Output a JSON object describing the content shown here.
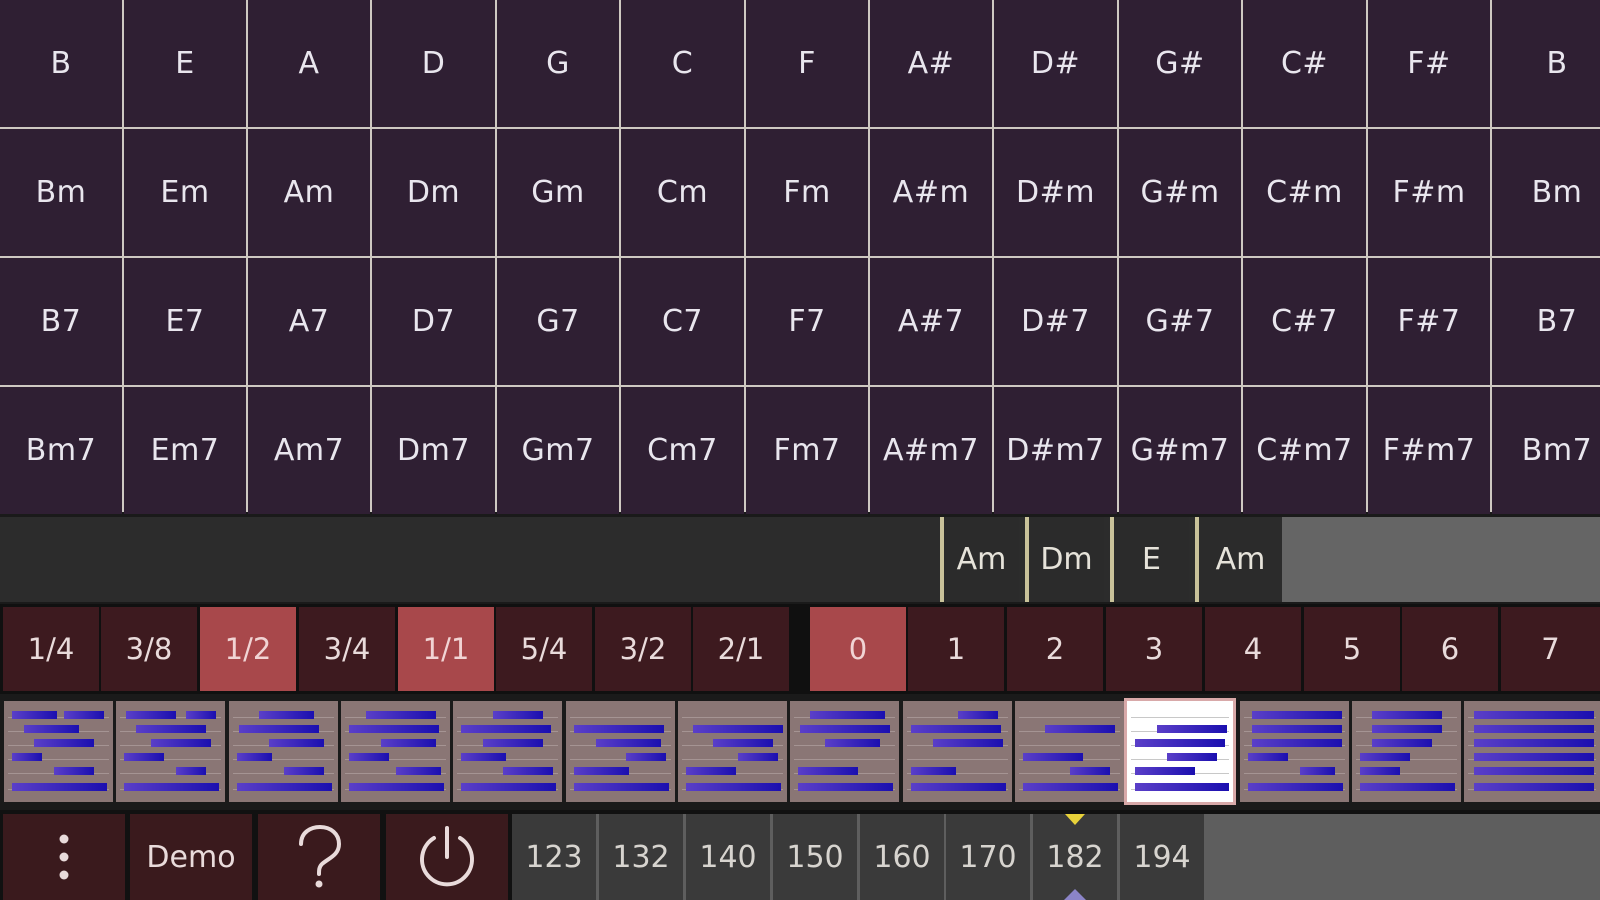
{
  "chord_grid": {
    "rows": [
      [
        "B",
        "E",
        "A",
        "D",
        "G",
        "C",
        "F",
        "A#",
        "D#",
        "G#",
        "C#",
        "F#",
        "B"
      ],
      [
        "Bm",
        "Em",
        "Am",
        "Dm",
        "Gm",
        "Cm",
        "Fm",
        "A#m",
        "D#m",
        "G#m",
        "C#m",
        "F#m",
        "Bm"
      ],
      [
        "B7",
        "E7",
        "A7",
        "D7",
        "G7",
        "C7",
        "F7",
        "A#7",
        "D#7",
        "G#7",
        "C#7",
        "F#7",
        "B7"
      ],
      [
        "Bm7",
        "Em7",
        "Am7",
        "Dm7",
        "Gm7",
        "Cm7",
        "Fm7",
        "A#m7",
        "D#m7",
        "G#m7",
        "C#m7",
        "F#m7",
        "Bm7"
      ]
    ]
  },
  "progression": [
    "Am",
    "Dm",
    "E",
    "Am"
  ],
  "lengths": {
    "items": [
      "1/4",
      "3/8",
      "1/2",
      "3/4",
      "1/1",
      "5/4",
      "3/2",
      "2/1"
    ],
    "active": [
      "1/2",
      "1/1"
    ]
  },
  "offsets": {
    "items": [
      "0",
      "1",
      "2",
      "3",
      "4",
      "5",
      "6",
      "7"
    ],
    "active": "0"
  },
  "patterns": {
    "count": 14,
    "selected_index": 10
  },
  "bottom": {
    "menu_icon": "more-vertical-icon",
    "demo_label": "Demo",
    "help_icon": "question-mark-icon",
    "power_icon": "power-icon"
  },
  "tempo": {
    "items": [
      "123",
      "132",
      "140",
      "150",
      "160",
      "170",
      "182",
      "194"
    ],
    "selected": "182"
  },
  "colors": {
    "grid_cell": "#2f1f33",
    "active_button": "#a8484b",
    "inactive_button": "#3d1a1f",
    "pattern_bar": "#1b0fb0",
    "tempo_marker": "#e8d23a"
  }
}
